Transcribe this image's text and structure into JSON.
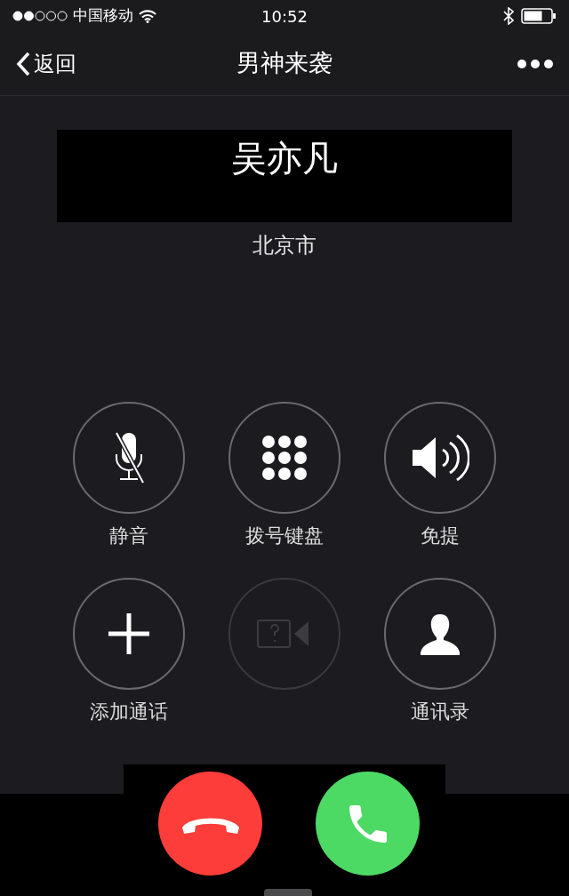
{
  "status_bar": {
    "carrier": "中国移动",
    "time": "10:52"
  },
  "nav_bar": {
    "back": "返回",
    "title": "男神来袭"
  },
  "caller": {
    "name": "吴亦凡",
    "location": "北京市"
  },
  "buttons": [
    {
      "kind": "mute",
      "label": "静音",
      "disabled": false
    },
    {
      "kind": "keypad",
      "label": "拨号键盘",
      "disabled": false
    },
    {
      "kind": "speaker",
      "label": "免提",
      "disabled": false
    },
    {
      "kind": "add",
      "label": "添加通话",
      "disabled": false
    },
    {
      "kind": "video",
      "disabled": true
    },
    {
      "kind": "contacts",
      "label": "通讯录",
      "disabled": false
    }
  ],
  "actions": [
    {
      "kind": "decline"
    },
    {
      "kind": "accept"
    }
  ]
}
